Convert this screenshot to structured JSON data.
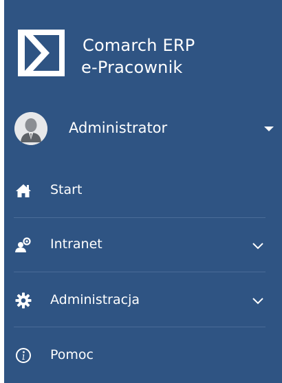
{
  "brand": {
    "line1": "Comarch ERP",
    "line2": "e-Pracownik",
    "logo_icon": "comarch-logo-icon"
  },
  "user": {
    "name": "Administrator",
    "avatar_icon": "user-avatar-icon",
    "caret_icon": "caret-down-icon"
  },
  "menu": {
    "items": [
      {
        "label": "Start",
        "icon": "home-icon"
      },
      {
        "label": "Intranet",
        "icon": "users-icon",
        "expandable": true
      },
      {
        "label": "Administracja",
        "icon": "gear-icon",
        "expandable": true
      },
      {
        "label": "Pomoc",
        "icon": "info-circle-icon"
      }
    ]
  },
  "colors": {
    "sidebar_bg": "#2f5483",
    "text": "#ffffff",
    "divider": "#4a6c98"
  }
}
